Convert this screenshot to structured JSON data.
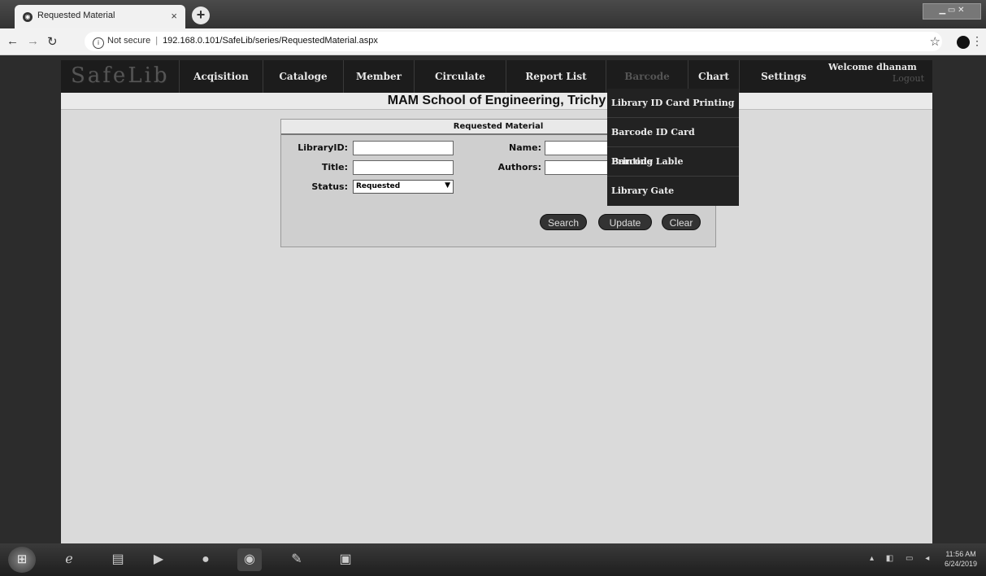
{
  "browser": {
    "tab_title": "Requested Material",
    "tab_close": "×",
    "new_tab": "+",
    "security_label": "Not secure",
    "url": "192.168.0.101/SafeLib/series/RequestedMaterial.aspx"
  },
  "app": {
    "logo": "SafeLib",
    "nav": {
      "acquisition": "Acqisition",
      "catalogue": "Cataloge",
      "member": "Member",
      "circulate": "Circulate",
      "report_list": "Report List",
      "barcode": "Barcode",
      "chart": "Chart",
      "settings": "Settings"
    },
    "welcome": "Welcome dhanam",
    "logout": "Logout",
    "school_name": "MAM School of Engineering, Trichy"
  },
  "form": {
    "title": "Requested Material",
    "library_id_label": "LibraryID:",
    "library_id_value": "",
    "name_label": "Name:",
    "name_value": "",
    "title_label": "Title:",
    "title_value": "",
    "authors_label": "Authors:",
    "authors_value": "",
    "status_label": "Status:",
    "status_value": "Requested",
    "buttons": {
      "search": "Search",
      "update": "Update",
      "clear": "Clear"
    }
  },
  "barcode_menu": [
    "Library ID Card Printing",
    "Barcode ID Card Printing",
    "Barcode Lable",
    "Library Gate"
  ],
  "taskbar": {
    "time": "11:56 AM",
    "date": "6/24/2019"
  }
}
